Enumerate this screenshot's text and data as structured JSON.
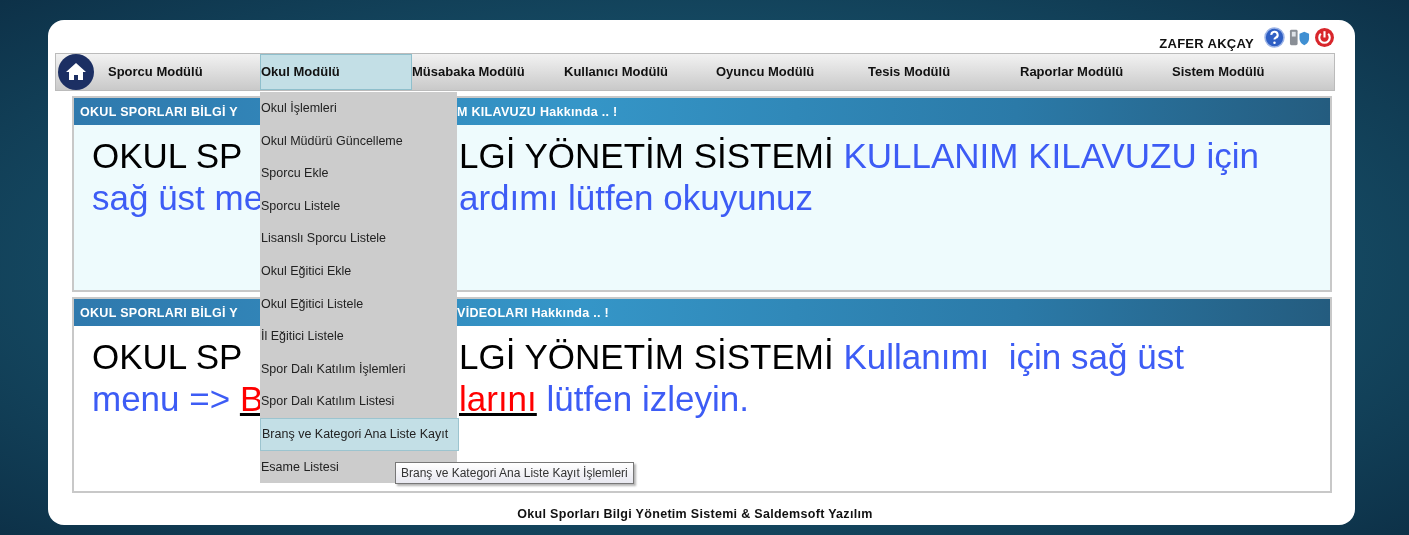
{
  "header": {
    "user_name": "ZAFER AKÇAY"
  },
  "nav": {
    "items": [
      {
        "label": "Sporcu Modülü",
        "selected": false
      },
      {
        "label": "Okul Modülü",
        "selected": true
      },
      {
        "label": "Müsabaka Modülü",
        "selected": false
      },
      {
        "label": "Kullanıcı Modülü",
        "selected": false
      },
      {
        "label": "Oyuncu Modülü",
        "selected": false
      },
      {
        "label": "Tesis Modülü",
        "selected": false
      },
      {
        "label": "Raporlar Modülü",
        "selected": false
      },
      {
        "label": "Sistem Modülü",
        "selected": false
      }
    ]
  },
  "dropdown": {
    "items": [
      {
        "label": "Okul İşlemleri",
        "selected": false
      },
      {
        "label": "Okul Müdürü Güncelleme",
        "selected": false
      },
      {
        "label": "Sporcu Ekle",
        "selected": false
      },
      {
        "label": "Sporcu Listele",
        "selected": false
      },
      {
        "label": "Lisanslı Sporcu Listele",
        "selected": false
      },
      {
        "label": "Okul Eğitici Ekle",
        "selected": false
      },
      {
        "label": "Okul Eğitici Listele",
        "selected": false
      },
      {
        "label": "İl Eğitici Listele",
        "selected": false
      },
      {
        "label": "Spor Dalı Katılım İşlemleri",
        "selected": false
      },
      {
        "label": "Spor Dalı Katılım Listesi",
        "selected": false
      },
      {
        "label": "Branş ve Kategori Ana Liste Kayıt",
        "selected": true
      },
      {
        "label": "Esame Listesi",
        "selected": false
      }
    ]
  },
  "tooltip": "Branş ve Kategori Ana Liste Kayıt İşlemleri",
  "panels": [
    {
      "tinted": true,
      "heading_left": "OKUL SPORLARI BİLGİ Y",
      "heading_right": "M KILAVUZU Hakkında .. !",
      "lines": [
        {
          "left": [
            {
              "kind": "plain",
              "text": "OKUL SP"
            }
          ],
          "right": [
            {
              "kind": "plain",
              "text": "LGİ YÖNETİM SİSTEMİ"
            },
            {
              "kind": "accent",
              "text": " KULLANIM KILAVUZU için"
            }
          ]
        },
        {
          "left": [
            {
              "kind": "accent",
              "text": "sağ üst me"
            }
          ],
          "right": [
            {
              "kind": "accent",
              "text": "ardımı lütfen okuyunuz"
            }
          ]
        }
      ]
    },
    {
      "tinted": false,
      "heading_left": "OKUL SPORLARI BİLGİ Y",
      "heading_right": "VİDEOLARI Hakkında .. !",
      "lines": [
        {
          "left": [
            {
              "kind": "plain",
              "text": "OKUL SP"
            }
          ],
          "right": [
            {
              "kind": "plain",
              "text": "LGİ YÖNETİM SİSTEMİ"
            },
            {
              "kind": "accent",
              "text": " Kullanımı  için sağ üst"
            }
          ]
        },
        {
          "left": [
            {
              "kind": "accent",
              "text": "menu => "
            },
            {
              "kind": "link",
              "text": "B"
            }
          ],
          "right": [
            {
              "kind": "link",
              "text": "larını"
            },
            {
              "kind": "accent",
              "text": " lütfen izleyin."
            }
          ]
        }
      ]
    }
  ],
  "footer": "Okul Sporları Bilgi Yönetim Sistemi & Saldemsoft Yazılım"
}
